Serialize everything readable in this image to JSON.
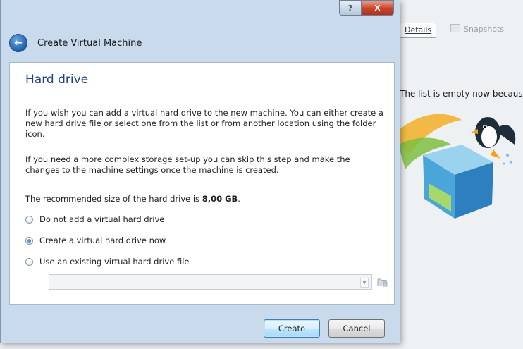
{
  "background_window": {
    "tabs": {
      "details": "Details",
      "snapshots": "Snapshots"
    },
    "empty_text": "The list is empty now because"
  },
  "dialog": {
    "window_buttons": {
      "help": "?",
      "close": "X"
    },
    "title": "Create Virtual Machine",
    "page": {
      "heading": "Hard drive",
      "paragraph_1": "If you wish you can add a virtual hard drive to the new machine. You can either create a new hard drive file or select one from the list or from another location using the folder icon.",
      "paragraph_2": "If you need a more complex storage set-up you can skip this step and make the changes to the machine settings once the machine is created.",
      "recommended_prefix": "The recommended size of the hard drive is ",
      "recommended_size": "8,00 GB",
      "recommended_suffix": ".",
      "options": [
        {
          "label": "Do not add a virtual hard drive",
          "checked": false
        },
        {
          "label": "Create a virtual hard drive now",
          "checked": true
        },
        {
          "label": "Use an existing virtual hard drive file",
          "checked": false
        }
      ],
      "existing_file_value": ""
    },
    "buttons": {
      "create": "Create",
      "cancel": "Cancel"
    }
  }
}
